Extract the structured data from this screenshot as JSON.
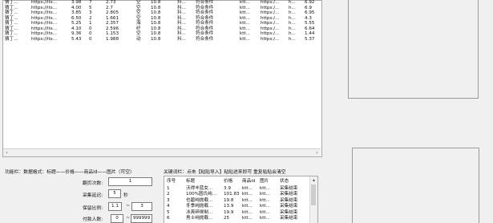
{
  "top_table": {
    "rows": [
      {
        "c1": "猜丁...",
        "url": "https://its...",
        "price": "3.98",
        "n": "7",
        "v": "2.73",
        "t": "空",
        "s": "10.8",
        "a": "抖...",
        "st": "符合条件",
        "k": "ktt...",
        "u2": "https:/...",
        "h": "h...",
        "x": "6.92"
      },
      {
        "c1": "猜丁...",
        "url": "https://its...",
        "price": "4.00",
        "n": "5",
        "v": "2.7",
        "t": "空",
        "s": "10.8",
        "a": "抖...",
        "st": "符合条件",
        "k": "ktt...",
        "u2": "https:/...",
        "h": "h...",
        "x": "6.9"
      },
      {
        "c1": "猜丁...",
        "url": "https://its...",
        "price": "3.85",
        "n": "3",
        "v": "2.805",
        "t": "空",
        "s": "10.8",
        "a": "抖...",
        "st": "符合条件",
        "k": "ktt...",
        "u2": "https:/...",
        "h": "h...",
        "x": "6.95"
      },
      {
        "c1": "猜丁...",
        "url": "https://its...",
        "price": "6.50",
        "n": "2",
        "v": "1.661",
        "t": "空",
        "s": "10.8",
        "a": "抖...",
        "st": "符合条件",
        "k": "ktt...",
        "u2": "https:/...",
        "h": "h...",
        "x": "4.3"
      },
      {
        "c1": "猜丁...",
        "url": "https://its...",
        "price": "5.25",
        "n": "1",
        "v": "2.357",
        "t": "海",
        "s": "10.8",
        "a": "抖...",
        "st": "符合条件",
        "k": "ktt...",
        "u2": "https:/...",
        "h": "h...",
        "x": "5.55"
      },
      {
        "c1": "猜丁...",
        "url": "https://its...",
        "price": "4.10",
        "n": "0",
        "v": "2.596",
        "t": "纤",
        "s": "10.8",
        "a": "抖...",
        "st": "符合条件",
        "k": "ktt...",
        "u2": "https:/...",
        "h": "h...",
        "x": "6.64"
      },
      {
        "c1": "猜丁...",
        "url": "https://its...",
        "price": "9.36",
        "n": "0",
        "v": "1.153",
        "t": "空",
        "s": "10.8",
        "a": "抖...",
        "st": "符合条件",
        "k": "ktt...",
        "u2": "https:/...",
        "h": "h...",
        "x": "1.44"
      },
      {
        "c1": "猜丁...",
        "url": "https://its...",
        "price": "5.43",
        "n": "0",
        "v": "1.988",
        "t": "动",
        "s": "10.8",
        "a": "抖...",
        "st": "符合条件",
        "k": "ktt...",
        "u2": "https:/...",
        "h": "h...",
        "x": "5.37"
      }
    ]
  },
  "scroll": {
    "left": "‹",
    "right": "›",
    "up": "▴",
    "down": "▾"
  },
  "function_panel": {
    "title": "功能栏：数据格式：标题——价格——商品id——图片（可空）",
    "flip_label": "翻页次数:",
    "flip_value": "1",
    "delay_label": "采集延迟:",
    "delay_value": "5",
    "delay_unit": "秒",
    "ratio_label": "保留比例:",
    "ratio_from": "1.1",
    "ratio_sep": "~",
    "ratio_to": "3",
    "pay_label": "付款人数:",
    "pay_from": "0",
    "pay_sep": "~",
    "pay_to": "999999"
  },
  "keyword_panel": {
    "title": "关键词栏：点击【粘贴导入】粘贴进来即可  重复粘贴会清空",
    "headers": {
      "no": "序号",
      "title": "标题",
      "price": "价格",
      "id": "商品id",
      "img": "图片",
      "status": "状态"
    },
    "rows": [
      {
        "no": "1",
        "title": "沃得丰蓝女...",
        "price": "3.9",
        "id": "ktt...",
        "img": "ktt...",
        "status": "采集结束"
      },
      {
        "no": "2",
        "title": "100%圆氏纯...",
        "price": "101.83",
        "id": "ktt...",
        "img": "ktt...",
        "status": "采集结束"
      },
      {
        "no": "3",
        "title": "也碧纯抛载...",
        "price": "19.8",
        "id": "ktt...",
        "img": "ktt...",
        "status": "采集结束"
      },
      {
        "no": "4",
        "title": "冬季纯抛载...",
        "price": "13.9",
        "id": "ktt...",
        "img": "ktt...",
        "status": "采集结束"
      },
      {
        "no": "5",
        "title": "冰爽碎绑制...",
        "price": "19.9",
        "id": "ktt...",
        "img": "ktt...",
        "status": "采集结束"
      },
      {
        "no": "6",
        "title": "男士纯抛载...",
        "price": "25",
        "id": "ktt...",
        "img": "ktt...",
        "status": "采集结束"
      }
    ]
  }
}
